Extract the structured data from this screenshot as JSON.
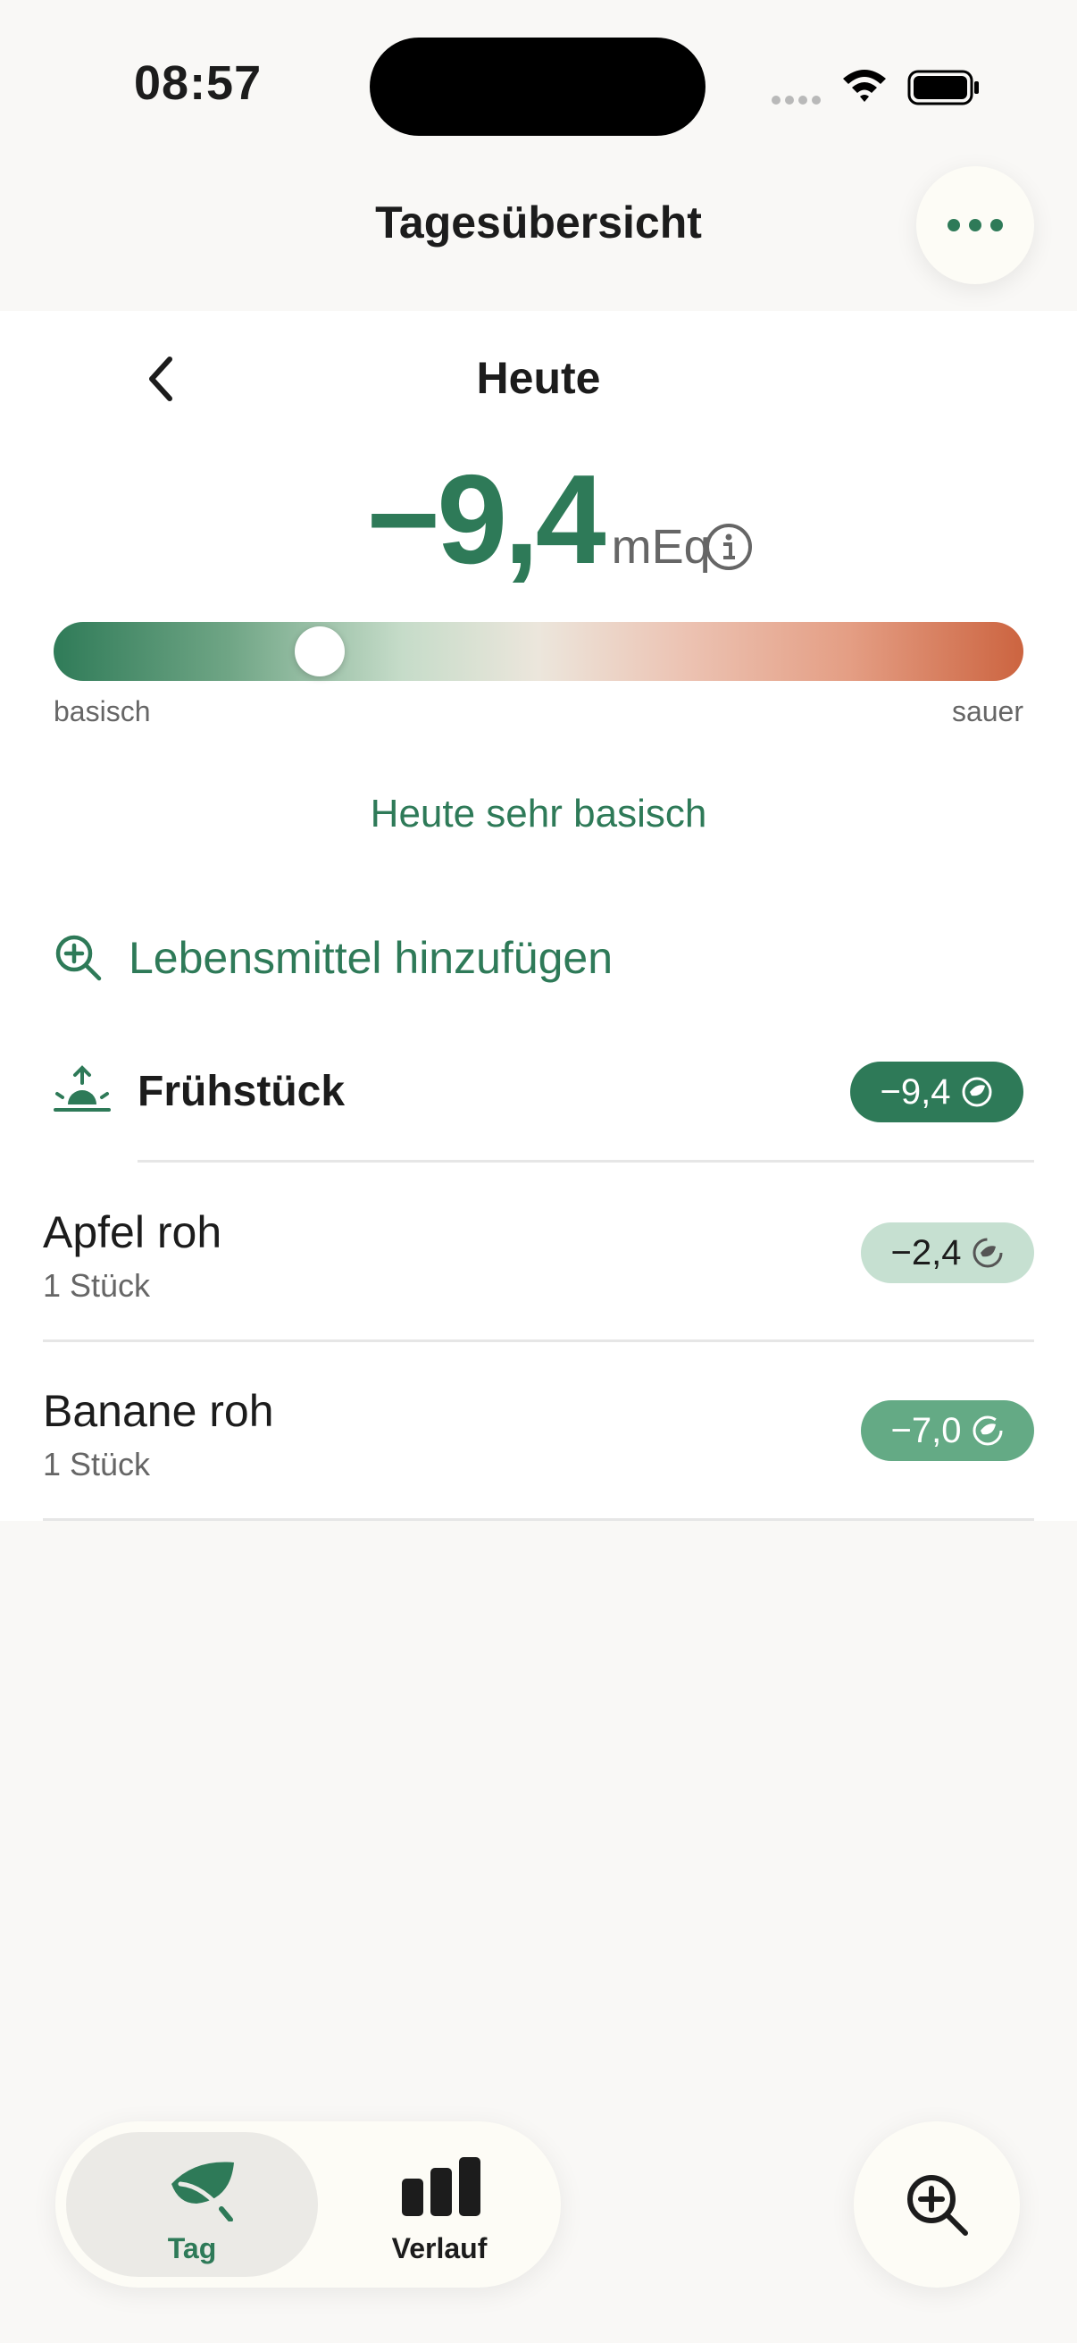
{
  "status_bar": {
    "time": "08:57"
  },
  "header": {
    "title": "Tagesübersicht",
    "more_icon": "ellipsis-icon"
  },
  "day": {
    "title": "Heute"
  },
  "score": {
    "value": "−9,4",
    "unit": "mEq",
    "scale_position": 0.26
  },
  "scale": {
    "left_label": "basisch",
    "right_label": "sauer"
  },
  "verdict": "Heute sehr basisch",
  "add_food": {
    "label": "Lebensmittel hinzufügen"
  },
  "meal": {
    "name": "Frühstück",
    "value": "−9,4"
  },
  "foods": [
    {
      "name": "Apfel roh",
      "quantity": "1 Stück",
      "value": "−2,4"
    },
    {
      "name": "Banane roh",
      "quantity": "1 Stück",
      "value": "−7,0"
    }
  ],
  "tabs": [
    {
      "label": "Tag",
      "icon": "leaf-icon",
      "active": true
    },
    {
      "label": "Verlauf",
      "icon": "bar-chart-icon",
      "active": false
    }
  ],
  "colors": {
    "accent": "#2e7a58",
    "acid": "#cc6440",
    "background": "#f9f8f6"
  }
}
